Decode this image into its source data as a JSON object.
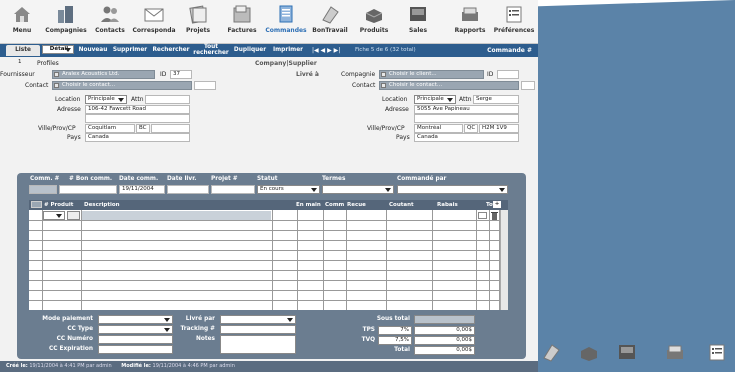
{
  "nav": {
    "items": [
      {
        "label": "Menu",
        "icon": "house-icon"
      },
      {
        "label": "Compagnies",
        "icon": "buildings-icon"
      },
      {
        "label": "Contacts",
        "icon": "people-icon"
      },
      {
        "label": "Corresponda",
        "icon": "envelope-icon"
      },
      {
        "label": "Projets",
        "icon": "projects-icon"
      },
      {
        "label": "Factures",
        "icon": "invoice-icon"
      },
      {
        "label": "Commandes",
        "icon": "orders-icon"
      },
      {
        "label": "BonTravail",
        "icon": "worksheet-icon"
      },
      {
        "label": "Produits",
        "icon": "products-icon"
      },
      {
        "label": "Sales",
        "icon": "sales-icon"
      },
      {
        "label": "Rapports",
        "icon": "reports-icon"
      },
      {
        "label": "Préférences",
        "icon": "preferences-icon"
      }
    ],
    "active": "Commandes"
  },
  "tabs": {
    "liste": "Liste",
    "detail": "Détail",
    "nouveau": "Nouveau",
    "supprimer": "Supprimer",
    "rechercher": "Rechercher",
    "tout1": "Tout",
    "tout2": "rechercher",
    "dupliquer": "Dupliquer",
    "imprimer": "Imprimer",
    "pager": "|◀ ◀ ▶ ▶|",
    "fiche": "Fiche 5 de 6 (32 total)",
    "commande": "Commande #"
  },
  "header": {
    "num": "1",
    "profiles": "Profiles",
    "company_supplier": "Company|Supplier",
    "livre_a": "Livré à"
  },
  "supplier": {
    "fournisseur_label": "Fournisseur",
    "fournisseur_value": "Aralex Acoustics Ltd.",
    "id_label": "ID",
    "id_value": "37",
    "contact_label": "Contact",
    "contact_value": "Choisir le contact...",
    "location_label": "Location",
    "location_value": "Principale",
    "attn_label": "Attn",
    "attn_value": "",
    "adresse_label": "Adresse",
    "adresse_value": "106-42 Fawcett Road",
    "ville_label": "Ville/Prov/CP",
    "ville_value": "Coquitlam",
    "prov_value": "BC",
    "cp_value": "",
    "pays_label": "Pays",
    "pays_value": "Canada"
  },
  "shipto": {
    "compagnie_label": "Compagnie",
    "compagnie_value": "Choisir le client...",
    "id_label": "ID",
    "id_value": "",
    "contact_label": "Contact",
    "contact_value": "Choisir le contact...",
    "location_label": "Location",
    "location_value": "Principale",
    "attn_label": "Attn",
    "attn_value": "Serge",
    "adresse_label": "Adresse",
    "adresse_value": "5055 Ave Papineau",
    "ville_label": "Ville/Prov/CP",
    "ville_value": "Montréal",
    "prov_value": "QC",
    "cp_value": "H2M 1V9",
    "pays_label": "Pays",
    "pays_value": "Canada"
  },
  "order": {
    "h_comm": "Comm. #",
    "h_bon": "# Bon comm.",
    "h_date": "Date comm.",
    "h_datelivr": "Date livr.",
    "h_projet": "Projet #",
    "h_statut": "Statut",
    "h_termes": "Termes",
    "h_commpar": "Commandé par",
    "date_value": "19/11/2004",
    "statut_value": "En cours"
  },
  "grid": {
    "h_produit": "# Produit",
    "h_desc": "Description",
    "h_enmain": "En main",
    "h_comm": "Comm",
    "h_recue": "Recue",
    "h_coutant": "Coutant",
    "h_rabais": "Rabais",
    "h_total": "Total",
    "add": "+"
  },
  "bottom": {
    "mode_label": "Mode paiement",
    "cctype_label": "CC Type",
    "ccnum_label": "CC Numéro",
    "ccexp_label": "CC Expiration",
    "livre_label": "Livré par",
    "tracking_label": "Tracking #",
    "notes_label": "Notes",
    "soustotal_label": "Sous total",
    "tps_label": "TPS",
    "tps_rate": "7%",
    "tps_value": "0,00$",
    "tvq_label": "TVQ",
    "tvq_rate": "7,5%",
    "tvq_value": "0,00$",
    "total_label": "Total",
    "total_value": "0,00$"
  },
  "footer": {
    "cree_label": "Créé le:",
    "cree_value": "19/11/2004 à 4:41 PM par admin",
    "modifie_label": "Modifié le:",
    "modifie_value": "19/11/2004 à 4:46 PM par admin"
  },
  "dock": {
    "icons": [
      "worksheet-icon",
      "products-icon",
      "sales-icon",
      "reports-icon",
      "preferences-icon"
    ]
  }
}
